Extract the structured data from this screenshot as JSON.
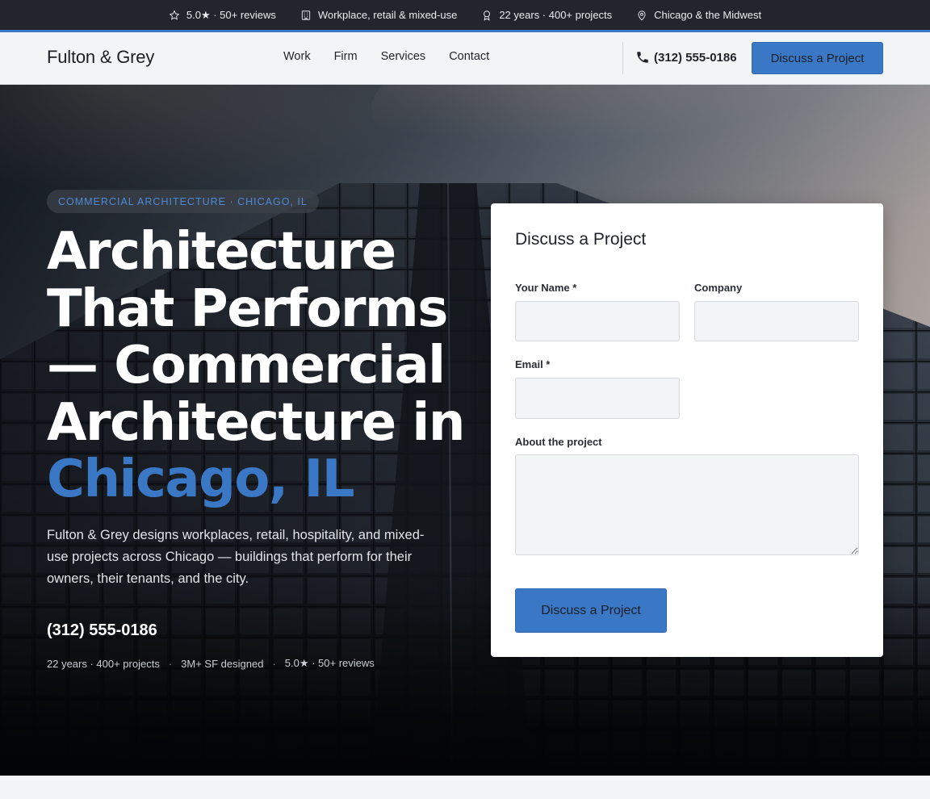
{
  "topbar": {
    "items": [
      {
        "icon": "star-icon",
        "text": "5.0★ · 50+ reviews"
      },
      {
        "icon": "building-icon",
        "text": "Workplace, retail & mixed-use"
      },
      {
        "icon": "award-icon",
        "text": "22 years · 400+ projects"
      },
      {
        "icon": "map-pin-icon",
        "text": "Chicago & the Midwest"
      }
    ]
  },
  "header": {
    "logo": "Fulton & Grey",
    "nav": [
      "Work",
      "Firm",
      "Services",
      "Contact"
    ],
    "phone": "(312) 555-0186",
    "cta": "Discuss a Project"
  },
  "hero": {
    "eyebrow": "COMMERCIAL ARCHITECTURE · CHICAGO, IL",
    "headline_main": "Architecture That Performs — Commercial Architecture in ",
    "headline_accent": "Chicago, IL",
    "lede": "Fulton & Grey designs workplaces, retail, hospitality, and mixed-use projects across Chicago — buildings that perform for their owners, their tenants, and the city.",
    "phone": "(312) 555-0186",
    "stats": [
      "22 years · 400+ projects",
      "3M+ SF designed",
      "5.0★ · 50+ reviews"
    ],
    "stat_separator": "·"
  },
  "form": {
    "title": "Discuss a Project",
    "name_label": "Your Name *",
    "company_label": "Company",
    "email_label": "Email *",
    "about_label": "About the project",
    "name_value": "",
    "company_value": "",
    "email_value": "",
    "about_value": "",
    "submit": "Discuss a Project"
  },
  "colors": {
    "accent": "#3a78c6",
    "topbar_bg": "#22262c",
    "page_bg": "#f3f4f6"
  }
}
